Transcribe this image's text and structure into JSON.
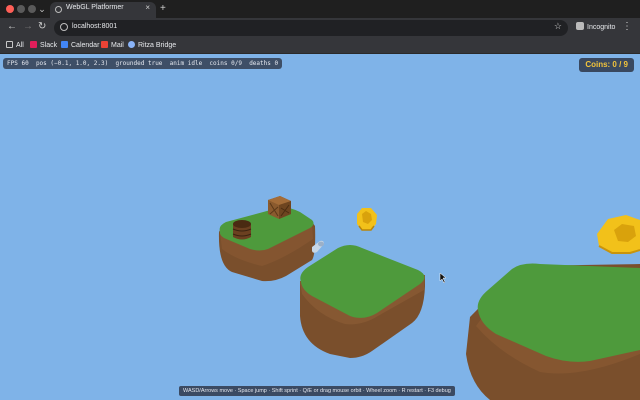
{
  "browser": {
    "tab_title": "WebGL Platformer",
    "new_tab": "+",
    "tab_close": "×",
    "url": "localhost:8001",
    "incognito": "Incognito",
    "bookmarks": [
      {
        "label": "All",
        "icon": "folder-icon",
        "color": "#9aa0a6"
      },
      {
        "label": "Slack",
        "icon": "slack-icon",
        "color": "#e01e5a"
      },
      {
        "label": "Calendar",
        "icon": "calendar-icon",
        "color": "#4285f4"
      },
      {
        "label": "Mail",
        "icon": "gmail-icon",
        "color": "#ea4335"
      },
      {
        "label": "Ritza Bridge",
        "icon": "rocket-icon",
        "color": "#8ab4f8"
      }
    ]
  },
  "game": {
    "debug": {
      "fps_label": "FPS",
      "fps": "60",
      "pos_label": "pos",
      "pos": "(−0.1, 1.0, 2.3)",
      "grounded_label": "grounded",
      "grounded": "true",
      "anim_label": "anim",
      "anim": "idle",
      "coins_label": "coins",
      "coins": "0/9",
      "deaths_label": "deaths",
      "deaths": "0"
    },
    "coins_counter": "Coins: 0 / 9",
    "help_text": "WASD/Arrows move · Space jump · Shift sprint · Q/E or drag mouse orbit · Wheel zoom · R restart · F3 debug",
    "colors": {
      "sky": "#7fb3e8",
      "grass": "#4e9a3c",
      "dirt": "#7a4f2c",
      "coin": "#f2c11a"
    }
  }
}
